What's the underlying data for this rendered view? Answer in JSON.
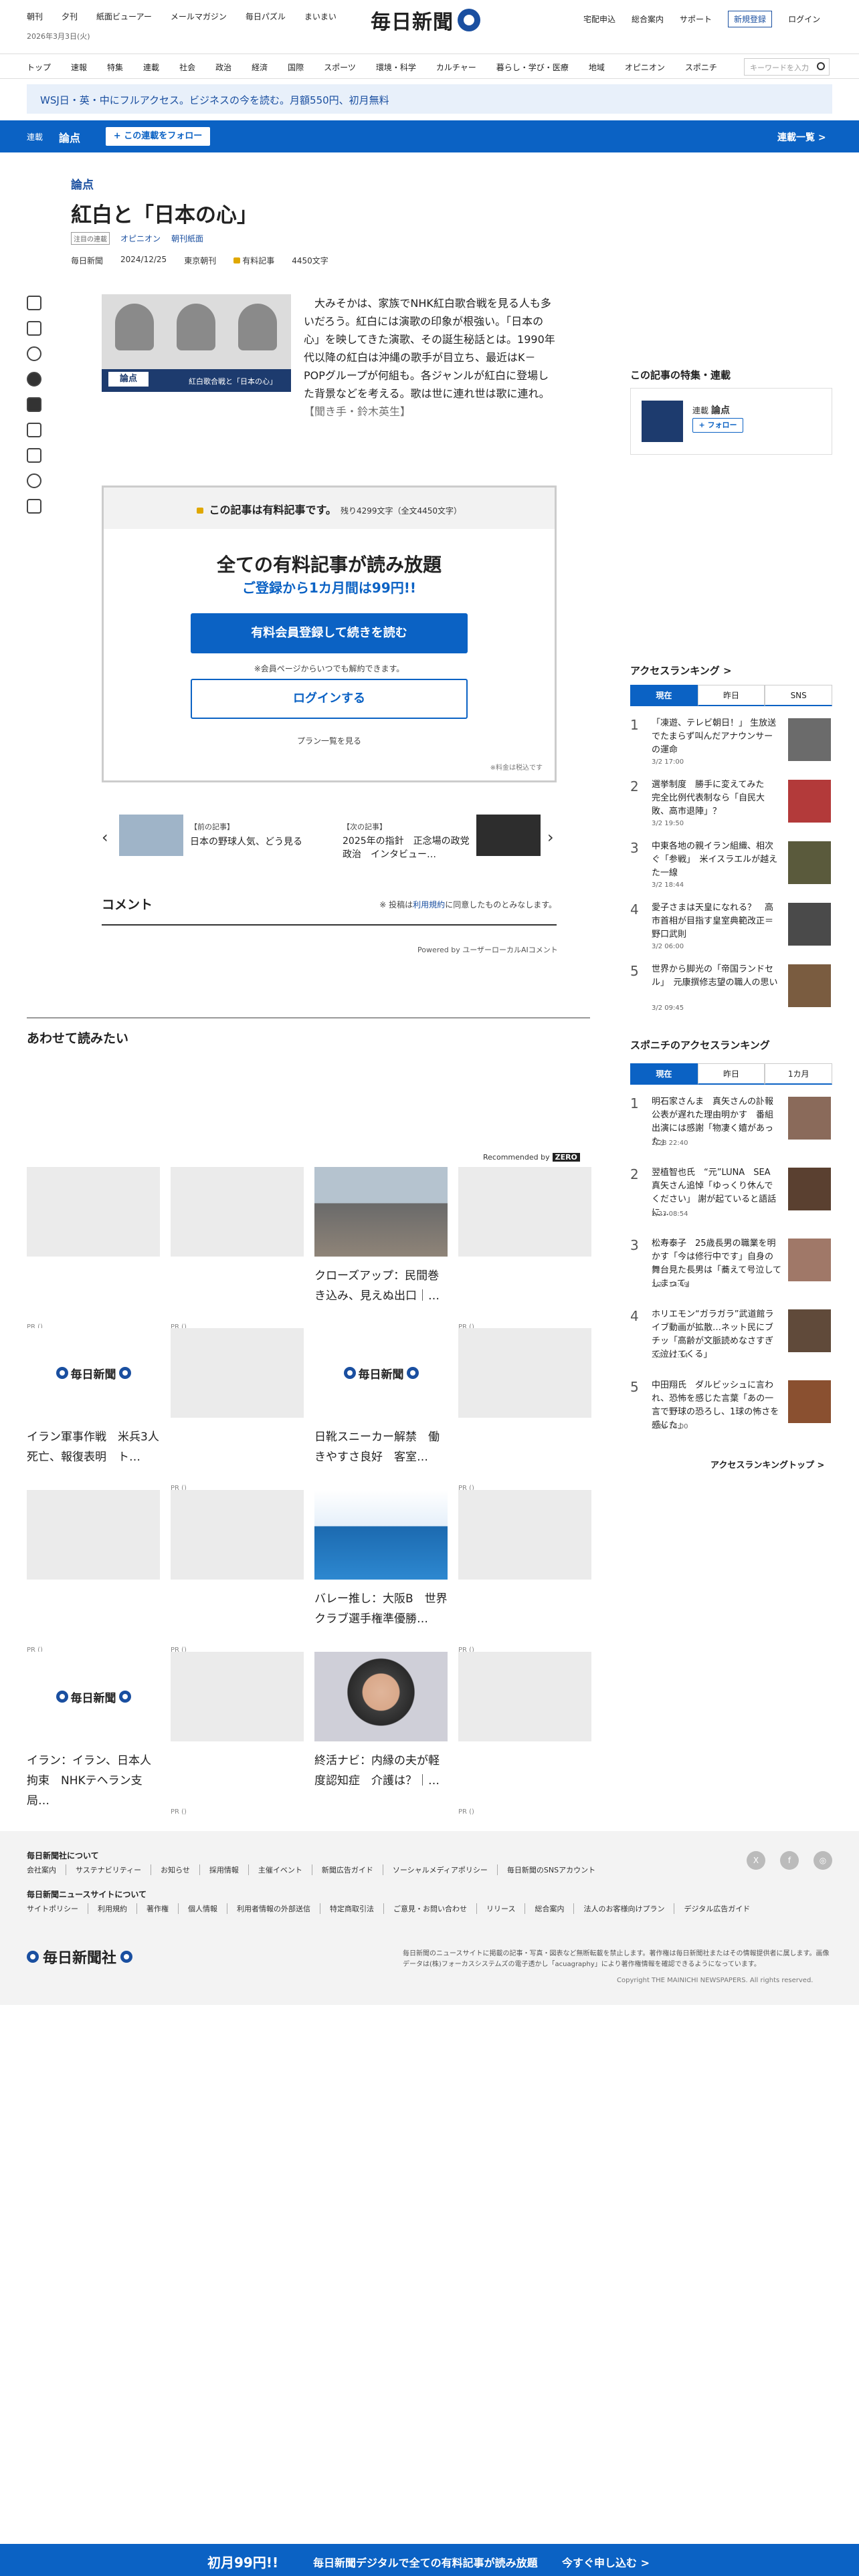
{
  "header": {
    "top_links": [
      "朝刊",
      "夕刊",
      "紙面ビューアー",
      "メールマガジン",
      "毎日パズル",
      "まいまい"
    ],
    "date": "2026年3月3日(火)",
    "logo_text": "毎日新聞",
    "right_links": [
      "宅配申込",
      "総合案内",
      "サポート"
    ],
    "register_label": "新規登録",
    "login_label": "ログイン"
  },
  "nav": {
    "items": [
      "トップ",
      "速報",
      "特集",
      "連載",
      "社会",
      "政治",
      "経済",
      "国際",
      "スポーツ",
      "環境・科学",
      "カルチャー",
      "暮らし・学び・医療",
      "地域",
      "オピニオン",
      "スポニチ"
    ],
    "search_placeholder": "キーワードを入力"
  },
  "promo_banner": "WSJ日・英・中にフルアクセス。ビジネスの今を読む。月額550円、初月無料",
  "series_bar": {
    "label": "連載",
    "title": "論点",
    "follow_label": "+ この連載をフォロー",
    "list_label": "連載一覧 >"
  },
  "article": {
    "kicker": "論点",
    "title": "紅白と「日本の心」",
    "tag_box": "注目の連載",
    "tags": [
      "オピニオン",
      "朝刊紙面"
    ],
    "meta": {
      "publisher": "毎日新聞",
      "date": "2024/12/25",
      "edition": "東京朝刊",
      "paid_label": "有料記事",
      "chars": "4450文字"
    },
    "hero_caption": "紅白歌合戦と「日本の心」",
    "hero_logo": "論点",
    "lead": "大みそかは、家族でNHK紅白歌合戦を見る人も多いだろう。紅白には演歌の印象が根強い。「日本の心」を映してきた演歌、その誕生秘話とは。1990年代以降の紅白は沖縄の歌手が目立ち、最近はK－POPグループが何組も。各ジャンルが紅白に登場した背景などを考える。歌は世に連れ世は歌に連れ。【聞き手・鈴木英生】"
  },
  "paywall": {
    "header": "この記事は有料記事です。",
    "remaining": "残り4299文字（全文4450文字）",
    "headline": "全ての有料記事が読み放題",
    "sub": "ご登録から1カ月間は99円!!",
    "subscribe_button": "有料会員登録して続きを読む",
    "note": "※会員ページからいつでも解約できます。",
    "login_button": "ログインする",
    "plans_link": "プラン一覧を見る",
    "tax_note": "※料金は税込です"
  },
  "prev_next": {
    "prev_label": "【前の記事】",
    "prev_title": "日本の野球人気、どう見る",
    "next_label": "【次の記事】",
    "next_title": "2025年の指針　正念場の政党政治　インタビュー…"
  },
  "comments": {
    "heading": "コメント",
    "notice_pre": "※ 投稿は",
    "notice_link": "利用規約",
    "notice_post": "に同意したものとみなします。",
    "powered_by": "Powered by ユーザーローカルAIコメント"
  },
  "recommend": {
    "heading": "あわせて読みたい",
    "recommended_by": "Recommended by",
    "provider": "ZERO",
    "tiles": [
      {
        "title": "",
        "pr": "PR ()",
        "img": "blank"
      },
      {
        "title": "",
        "pr": "PR ()",
        "img": "blank"
      },
      {
        "title": "クローズアップ：民間巻き込み、見えぬ出口｜…",
        "pr": "",
        "img": "photo1"
      },
      {
        "title": "",
        "pr": "PR ()",
        "img": "blank"
      },
      {
        "title": "イラン軍事作戦　米兵3人死亡、報復表明　ト…",
        "pr": "",
        "img": "mlogo"
      },
      {
        "title": "",
        "pr": "PR ()",
        "img": "blank"
      },
      {
        "title": "日靴スニーカー解禁　働きやすさ良好　客室…",
        "pr": "",
        "img": "mlogo"
      },
      {
        "title": "",
        "pr": "PR ()",
        "img": "blank"
      },
      {
        "title": "",
        "pr": "PR ()",
        "img": "blank"
      },
      {
        "title": "",
        "pr": "PR ()",
        "img": "blank"
      },
      {
        "title": "バレー推し：大阪B　世界クラブ選手権準優勝…",
        "pr": "",
        "img": "photo2"
      },
      {
        "title": "",
        "pr": "PR ()",
        "img": "blank"
      },
      {
        "title": "イラン：イラン、日本人拘束　NHKテヘラン支局…",
        "pr": "",
        "img": "mlogo"
      },
      {
        "title": "",
        "pr": "PR ()",
        "img": "blank"
      },
      {
        "title": "終活ナビ：内縁の夫が軽度認知症　介護は？｜…",
        "pr": "",
        "img": "photo3"
      },
      {
        "title": "",
        "pr": "PR ()",
        "img": "blank"
      }
    ]
  },
  "sidebar": {
    "feature_heading": "この記事の特集・連載",
    "feature_label": "連載",
    "feature_name": "論点",
    "feature_follow": "+ フォロー",
    "ranking_heading": "アクセスランキング >",
    "ranking_tabs": [
      "現在",
      "昨日",
      "SNS"
    ],
    "ranking": [
      {
        "n": "1",
        "title": "「凍遊、テレビ朝日！」 生放送でたまらず叫んだアナウンサーの運命",
        "date": "3/2 17:00"
      },
      {
        "n": "2",
        "title": "選挙制度　勝手に変えてみた　完全比例代表制なら「自民大敗、高市退陣」？",
        "date": "3/2 19:50"
      },
      {
        "n": "3",
        "title": "中東各地の親イラン組織、相次ぐ「参戦」　米イスラエルが越えた一線",
        "date": "3/2 18:44"
      },
      {
        "n": "4",
        "title": "愛子さまは天皇になれる？　高市首相が目指す皇室典範改正＝野口武則",
        "date": "3/2 06:00"
      },
      {
        "n": "5",
        "title": "世界から脚光の「帝国ランドセル」　元康撰修志望の職人の思い",
        "date": "3/2 09:45"
      }
    ],
    "sponichi_heading": "スポニチのアクセスランキング",
    "sponichi_tabs": [
      "現在",
      "昨日",
      "1カ月"
    ],
    "sponichi": [
      {
        "n": "1",
        "title": "明石家さんま　真矢さんの訃報公表が遅れた理由明かす　番組出演には感謝「物凄く嬉があった」",
        "date": "2/28 22:40"
      },
      {
        "n": "2",
        "title": "翌植智也氏　“元”LUNA　SEA　真矢さん追悼「ゆっくり休んでください」 謝が起ていると語話に…",
        "date": "2/23 08:54"
      },
      {
        "n": "3",
        "title": "松寿泰子　25歳長男の職業を明かす「今は修行中です」自身の舞台見た長男は「蕎えて号泣してしまって」",
        "date": "2/27 14:49"
      },
      {
        "n": "4",
        "title": "ホリエモン“ガラガラ”武道館ライブ動画が拡散…ネット民にブチッ「高齢が文脈読めなさすぎて泣けてくる」",
        "date": "2/27 21:34"
      },
      {
        "n": "5",
        "title": "中田翔氏　ダルビッシュに言われ、恐怖を感じた言葉「あの一言で野球の恐ろし、1球の怖さを感じた」",
        "date": "2/24 14:00"
      }
    ],
    "ranking_top": "アクセスランキングトップ >"
  },
  "footer": {
    "about_heading": "毎日新聞社について",
    "about_links": [
      "会社案内",
      "サステナビリティー",
      "お知らせ",
      "採用情報",
      "主催イベント",
      "新聞広告ガイド",
      "ソーシャルメディアポリシー",
      "毎日新聞のSNSアカウント"
    ],
    "site_heading": "毎日新聞ニュースサイトについて",
    "site_links": [
      "サイトポリシー",
      "利用規約",
      "著作権",
      "個人情報",
      "利用者情報の外部送信",
      "特定商取引法",
      "ご意見・お問い合わせ",
      "リリース",
      "総合案内",
      "法人のお客様向けプラン",
      "デジタル広告ガイド"
    ],
    "social": [
      "X",
      "f",
      "◎"
    ],
    "logo_text": "毎日新聞社",
    "note": "毎日新聞のニュースサイトに掲載の記事・写真・図表など無断転載を禁止します。著作権は毎日新聞社またはその情報提供者に属します。画像データは(株)フォーカスシステムズの電子透かし「acuagraphy」により著作権情報を確認できるようになっています。",
    "copyright": "Copyright THE MAINICHI NEWSPAPERS. All rights reserved."
  },
  "bottom_bar": {
    "price": "初月99円!!",
    "message": "毎日新聞デジタルで全ての有料記事が読み放題",
    "cta": "今すぐ申し込む >"
  }
}
